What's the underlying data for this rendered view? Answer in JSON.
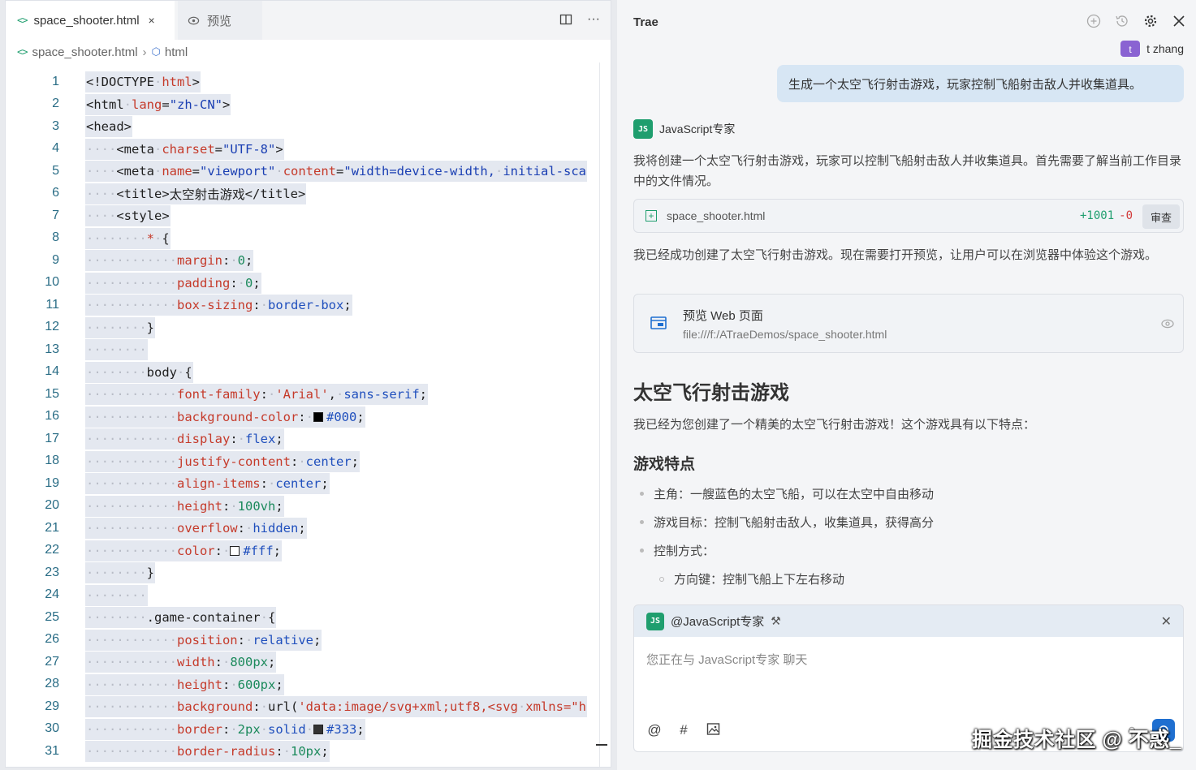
{
  "editor": {
    "tabs": {
      "active": {
        "label": "space_shooter.html",
        "icon": "code-file-icon",
        "close": "×"
      },
      "preview": {
        "label": "预览",
        "icon": "eye-icon"
      }
    },
    "breadcrumb": {
      "file": "space_shooter.html",
      "node": "html"
    },
    "lines": [
      {
        "n": "1",
        "html": "<span class='tg'>&lt;!DOCTYPE</span><span class='ws'>·</span><span class='at'>html</span><span class='tg'>&gt;</span>"
      },
      {
        "n": "2",
        "html": "<span class='tg'>&lt;html</span><span class='ws'>·</span><span class='at'>lang</span><span class='pn'>=</span><span class='vl'>\"zh-CN\"</span><span class='tg'>&gt;</span>"
      },
      {
        "n": "3",
        "html": "<span class='tg'>&lt;head&gt;</span>"
      },
      {
        "n": "4",
        "html": "<span class='ws'>····</span><span class='tg'>&lt;meta</span><span class='ws'>·</span><span class='at'>charset</span><span class='pn'>=</span><span class='vl'>\"UTF-8\"</span><span class='tg'>&gt;</span>"
      },
      {
        "n": "5",
        "html": "<span class='ws'>····</span><span class='tg'>&lt;meta</span><span class='ws'>·</span><span class='at'>name</span><span class='pn'>=</span><span class='vl'>\"viewport\"</span><span class='ws'>·</span><span class='at'>content</span><span class='pn'>=</span><span class='vl'>\"width=device-width,</span><span class='ws'>·</span><span class='vl'>initial-sca</span>"
      },
      {
        "n": "6",
        "html": "<span class='ws'>····</span><span class='tg'>&lt;title&gt;</span><span class='pn'>太空射击游戏</span><span class='tg'>&lt;/title&gt;</span>"
      },
      {
        "n": "7",
        "html": "<span class='ws'>····</span><span class='tg'>&lt;style&gt;</span>"
      },
      {
        "n": "8",
        "html": "<span class='ws'>········</span><span class='pp'>*</span><span class='ws'>·</span><span class='pn'>{</span>"
      },
      {
        "n": "9",
        "html": "<span class='ws'>············</span><span class='pp'>margin</span><span class='pn'>:</span><span class='ws'>·</span><span class='nm'>0</span><span class='pn'>;</span>"
      },
      {
        "n": "10",
        "html": "<span class='ws'>············</span><span class='pp'>padding</span><span class='pn'>:</span><span class='ws'>·</span><span class='nm'>0</span><span class='pn'>;</span>"
      },
      {
        "n": "11",
        "html": "<span class='ws'>············</span><span class='pp'>box-sizing</span><span class='pn'>:</span><span class='ws'>·</span><span class='kw'>border-box</span><span class='pn'>;</span>"
      },
      {
        "n": "12",
        "html": "<span class='ws'>········</span><span class='pn'>}</span>"
      },
      {
        "n": "13",
        "html": "<span class='ws'>········</span>"
      },
      {
        "n": "14",
        "html": "<span class='ws'>········</span><span class='tg'>body</span><span class='ws'>·</span><span class='pn'>{</span>"
      },
      {
        "n": "15",
        "html": "<span class='ws'>············</span><span class='pp'>font-family</span><span class='pn'>:</span><span class='ws'>·</span><span class='at'>'Arial'</span><span class='pn'>,</span><span class='ws'>·</span><span class='kw'>sans-serif</span><span class='pn'>;</span>"
      },
      {
        "n": "16",
        "html": "<span class='ws'>············</span><span class='pp'>background-color</span><span class='pn'>:</span><span class='ws'>·</span><span class='sw' style='background:#000'></span><span class='kw'>#000</span><span class='pn'>;</span>"
      },
      {
        "n": "17",
        "html": "<span class='ws'>············</span><span class='pp'>display</span><span class='pn'>:</span><span class='ws'>·</span><span class='kw'>flex</span><span class='pn'>;</span>"
      },
      {
        "n": "18",
        "html": "<span class='ws'>············</span><span class='pp'>justify-content</span><span class='pn'>:</span><span class='ws'>·</span><span class='kw'>center</span><span class='pn'>;</span>"
      },
      {
        "n": "19",
        "html": "<span class='ws'>············</span><span class='pp'>align-items</span><span class='pn'>:</span><span class='ws'>·</span><span class='kw'>center</span><span class='pn'>;</span>"
      },
      {
        "n": "20",
        "html": "<span class='ws'>············</span><span class='pp'>height</span><span class='pn'>:</span><span class='ws'>·</span><span class='nm'>100vh</span><span class='pn'>;</span>"
      },
      {
        "n": "21",
        "html": "<span class='ws'>············</span><span class='pp'>overflow</span><span class='pn'>:</span><span class='ws'>·</span><span class='kw'>hidden</span><span class='pn'>;</span>"
      },
      {
        "n": "22",
        "html": "<span class='ws'>············</span><span class='pp'>color</span><span class='pn'>:</span><span class='ws'>·</span><span class='sw' style='background:#fff'></span><span class='kw'>#fff</span><span class='pn'>;</span>"
      },
      {
        "n": "23",
        "html": "<span class='ws'>········</span><span class='pn'>}</span>"
      },
      {
        "n": "24",
        "html": "<span class='ws'>········</span>"
      },
      {
        "n": "25",
        "html": "<span class='ws'>········</span><span class='tg'>.game-container</span><span class='ws'>·</span><span class='pn'>{</span>"
      },
      {
        "n": "26",
        "html": "<span class='ws'>············</span><span class='pp'>position</span><span class='pn'>:</span><span class='ws'>·</span><span class='kw'>relative</span><span class='pn'>;</span>"
      },
      {
        "n": "27",
        "html": "<span class='ws'>············</span><span class='pp'>width</span><span class='pn'>:</span><span class='ws'>·</span><span class='nm'>800px</span><span class='pn'>;</span>"
      },
      {
        "n": "28",
        "html": "<span class='ws'>············</span><span class='pp'>height</span><span class='pn'>:</span><span class='ws'>·</span><span class='nm'>600px</span><span class='pn'>;</span>"
      },
      {
        "n": "29",
        "html": "<span class='ws'>············</span><span class='pp'>background</span><span class='pn'>:</span><span class='ws'>·</span><span class='pn'>url(</span><span class='at'>'data:image/svg+xml;utf8,&lt;svg</span><span class='ws'>·</span><span class='at'>xmlns=\"h</span>"
      },
      {
        "n": "30",
        "html": "<span class='ws'>············</span><span class='pp'>border</span><span class='pn'>:</span><span class='ws'>·</span><span class='nm'>2px</span><span class='ws'>·</span><span class='kw'>solid</span><span class='ws'>·</span><span class='sw' style='background:#333'></span><span class='kw'>#333</span><span class='pn'>;</span>"
      },
      {
        "n": "31",
        "html": "<span class='ws'>············</span><span class='pp'>border-radius</span><span class='pn'>:</span><span class='ws'>·</span><span class='nm'>10px</span><span class='pn'>;</span>"
      }
    ]
  },
  "chat": {
    "title": "Trae",
    "user": {
      "avatar_letter": "t",
      "name": "t zhang",
      "message": "生成一个太空飞行射击游戏，玩家控制飞船射击敌人并收集道具。"
    },
    "bot": {
      "avatar_text": "JS",
      "name": "JavaScript专家"
    },
    "para1": "我将创建一个太空飞行射击游戏，玩家可以控制飞船射击敌人并收集道具。首先需要了解当前工作目录中的文件情况。",
    "file_card": {
      "name": "space_shooter.html",
      "additions": "+1001",
      "deletions": "-0",
      "review": "审查"
    },
    "para2": "我已经成功创建了太空飞行射击游戏。现在需要打开预览，让用户可以在浏览器中体验这个游戏。",
    "preview_card": {
      "title": "预览 Web 页面",
      "path": "file:///f:/ATraeDemos/space_shooter.html"
    },
    "heading": "太空飞行射击游戏",
    "intro": "我已经为您创建了一个精美的太空飞行射击游戏！这个游戏具有以下特点：",
    "subheading": "游戏特点",
    "bullets": [
      "主角：一艘蓝色的太空飞船，可以在太空中自由移动",
      "游戏目标：控制飞船射击敌人，收集道具，获得高分",
      "控制方式："
    ],
    "sub_bullet": "方向键：控制飞船上下左右移动",
    "agent_tag": "@JavaScript专家",
    "input_placeholder": "您正在与 JavaScript专家 聊天",
    "watermark": "掘金技术社区 @ 不惑_"
  },
  "colors": {
    "accent_green": "#1f9e6e",
    "user_bubble": "#d7e6f4",
    "send_blue": "#1f6fd0"
  }
}
